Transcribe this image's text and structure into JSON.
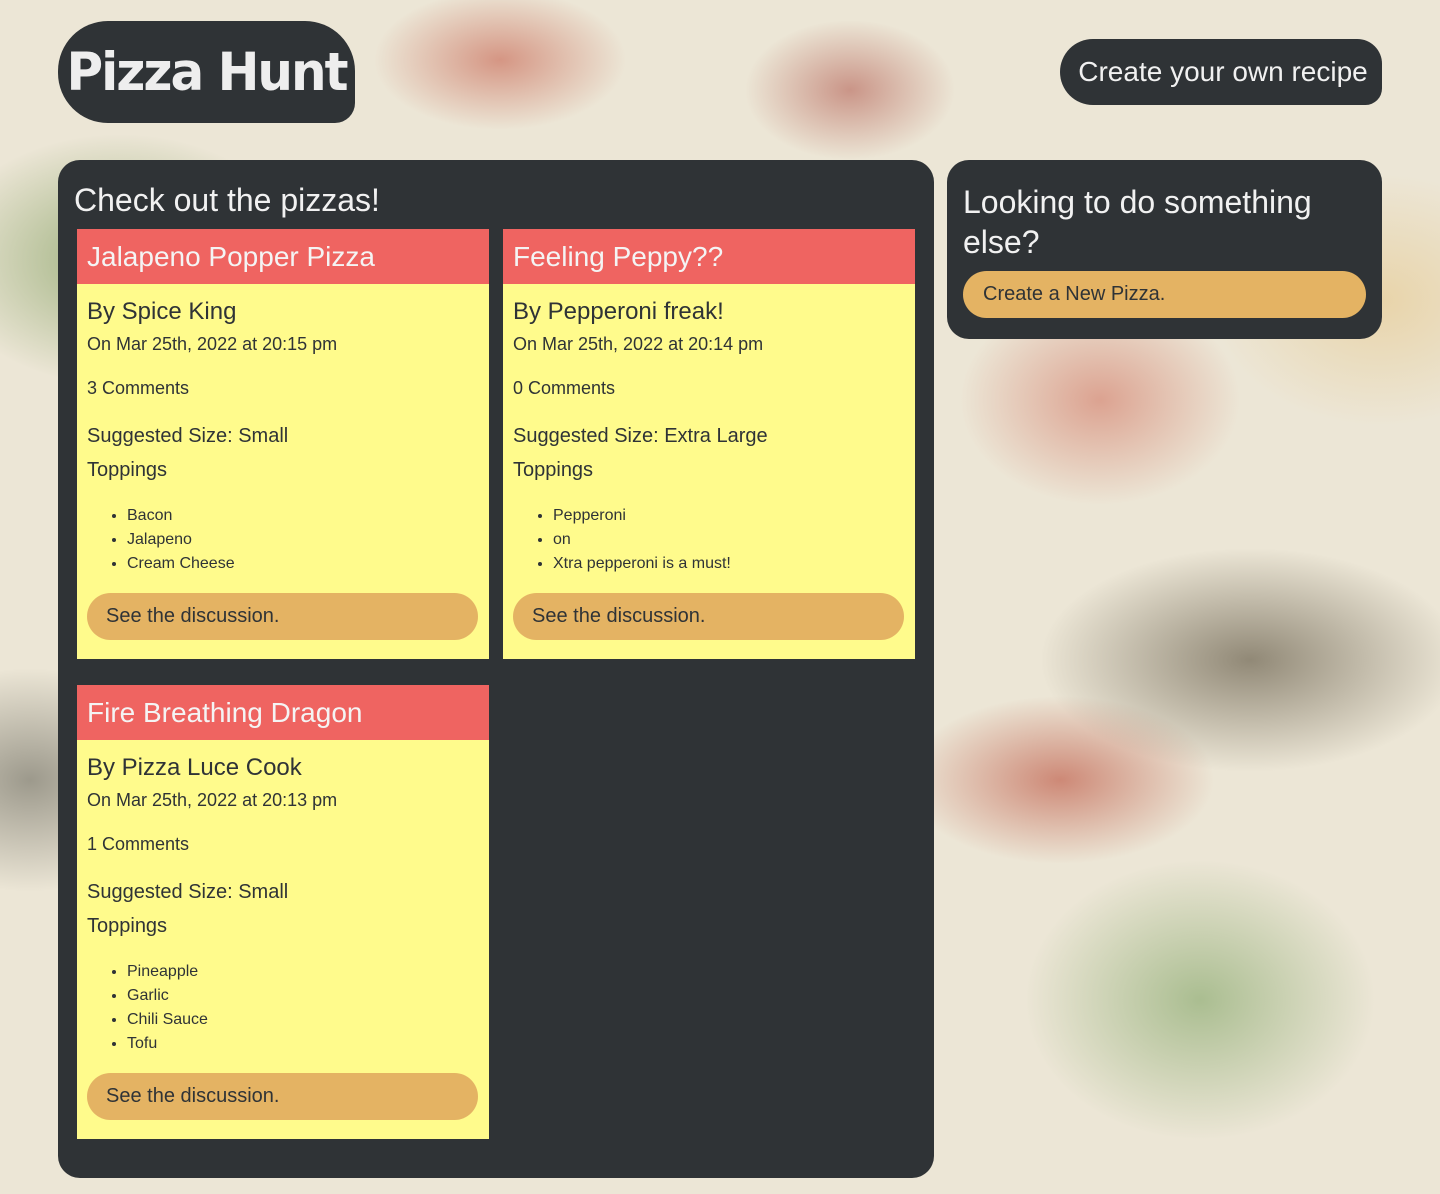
{
  "header": {
    "logo_text": "Pizza Hunt",
    "create_link": "Create your own recipe"
  },
  "main": {
    "title": "Check out the pizzas!",
    "pizzas": [
      {
        "name": "Jalapeno Popper Pizza",
        "author": "By Spice King",
        "date": "On Mar 25th, 2022 at 20:15 pm",
        "comments": "3 Comments",
        "size": "Suggested Size: Small",
        "toppings_label": "Toppings",
        "toppings": [
          "Bacon",
          "Jalapeno",
          "Cream Cheese"
        ],
        "discussion": "See the discussion."
      },
      {
        "name": "Feeling Peppy??",
        "author": "By Pepperoni freak!",
        "date": "On Mar 25th, 2022 at 20:14 pm",
        "comments": "0 Comments",
        "size": "Suggested Size: Extra Large",
        "toppings_label": "Toppings",
        "toppings": [
          "Pepperoni",
          "on",
          "Xtra pepperoni is a must!"
        ],
        "discussion": "See the discussion."
      },
      {
        "name": "Fire Breathing Dragon",
        "author": "By Pizza Luce Cook",
        "date": "On Mar 25th, 2022 at 20:13 pm",
        "comments": "1 Comments",
        "size": "Suggested Size: Small",
        "toppings_label": "Toppings",
        "toppings": [
          "Pineapple",
          "Garlic",
          "Chili Sauce",
          "Tofu"
        ],
        "discussion": "See the discussion."
      }
    ]
  },
  "sidebar": {
    "title": "Looking to do something else?",
    "button": "Create a New Pizza."
  },
  "colors": {
    "panel": "#2f3336",
    "card": "#fffb8c",
    "card_header": "#ef6461",
    "button": "#e4b363"
  }
}
